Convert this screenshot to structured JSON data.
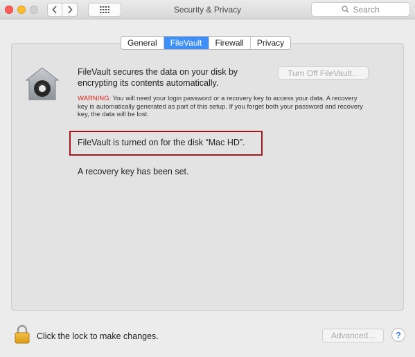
{
  "window": {
    "title": "Security & Privacy",
    "search_placeholder": "Search"
  },
  "tabs": [
    {
      "label": "General",
      "active": false
    },
    {
      "label": "FileVault",
      "active": true
    },
    {
      "label": "Firewall",
      "active": false
    },
    {
      "label": "Privacy",
      "active": false
    }
  ],
  "filevault": {
    "description": "FileVault secures the data on your disk by encrypting its contents automatically.",
    "turn_off_label": "Turn Off FileVault...",
    "warning_label": "WARNING:",
    "warning_text": " You will need your login password or a recovery key to access your data. A recovery key is automatically generated as part of this setup. If you forget both your password and recovery key, the data will be lost.",
    "status": "FileVault is turned on for the disk “Mac HD”.",
    "recovery": "A recovery key has been set."
  },
  "footer": {
    "lock_text": "Click the lock to make changes.",
    "advanced_label": "Advanced...",
    "help_label": "?"
  },
  "colors": {
    "accent": "#3d8ff7",
    "warning": "#e0231c",
    "highlight_border": "#a4161a"
  }
}
